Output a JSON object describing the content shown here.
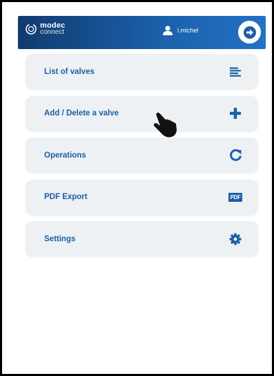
{
  "app": {
    "brand": "modec",
    "product": "connect"
  },
  "header": {
    "username": "l.michel",
    "logout_icon": "logout-icon",
    "user_icon": "user-icon"
  },
  "menu": {
    "items": [
      {
        "label": "List of valves",
        "icon": "list-icon"
      },
      {
        "label": "Add / Delete a valve",
        "icon": "plus-icon"
      },
      {
        "label": "Operations",
        "icon": "refresh-icon"
      },
      {
        "label": "PDF Export",
        "icon": "pdf-icon",
        "badge": "PDF"
      },
      {
        "label": "Settings",
        "icon": "gear-icon"
      }
    ]
  },
  "colors": {
    "accent": "#1c5ea6",
    "header_start": "#113a6e",
    "header_end": "#2372c4",
    "item_bg": "#edf1f4"
  }
}
